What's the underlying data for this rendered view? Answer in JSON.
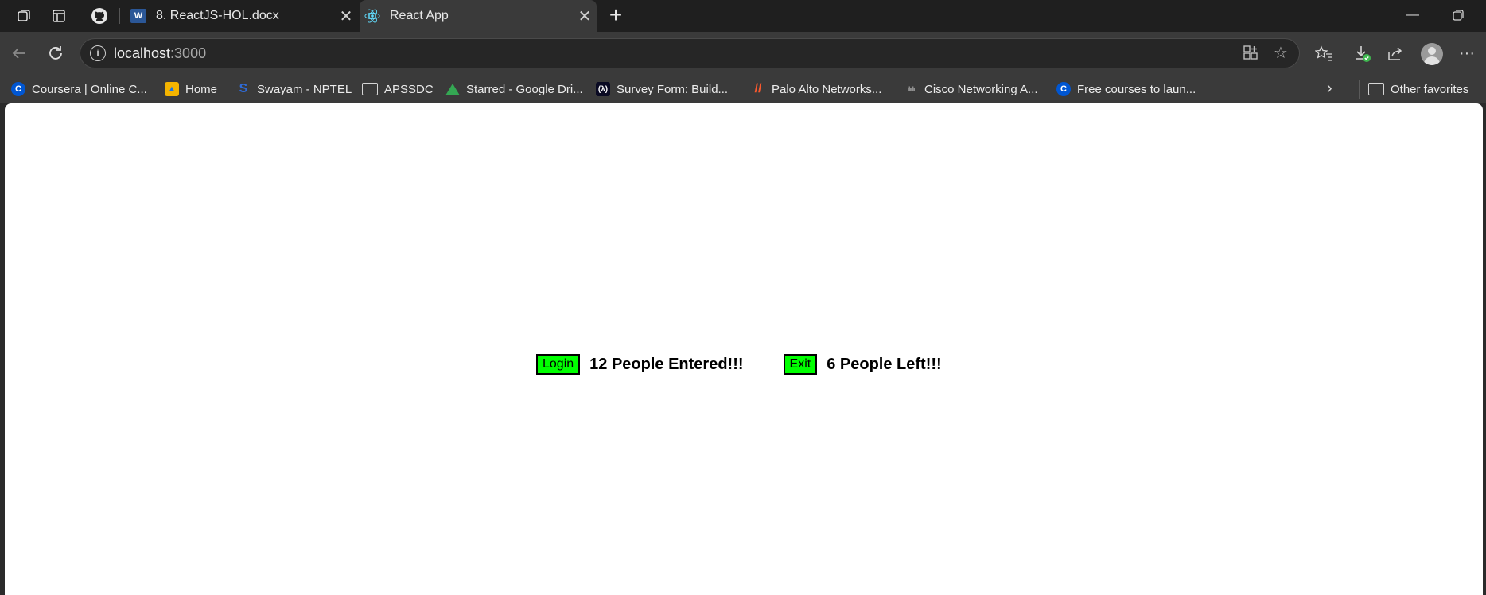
{
  "browser": {
    "tabs": [
      {
        "title": "8. ReactJS-HOL.docx",
        "active": false,
        "icon": "word-icon"
      },
      {
        "title": "React App",
        "active": true,
        "icon": "react-icon"
      }
    ],
    "address": {
      "host": "localhost",
      "port": ":3000"
    },
    "favorites": [
      {
        "label": "Coursera | Online C...",
        "icon": "coursera-icon"
      },
      {
        "label": "Home",
        "icon": "home-icon"
      },
      {
        "label": "Swayam - NPTEL",
        "icon": "swayam-icon"
      },
      {
        "label": "APSSDC",
        "icon": "folder-icon"
      },
      {
        "label": "Starred - Google Dri...",
        "icon": "google-drive-icon"
      },
      {
        "label": "Survey Form: Build...",
        "icon": "freecodecamp-icon"
      },
      {
        "label": "Palo Alto Networks...",
        "icon": "palo-alto-icon"
      },
      {
        "label": "Cisco Networking A...",
        "icon": "cisco-icon"
      },
      {
        "label": "Free courses to laun...",
        "icon": "coursera-icon"
      }
    ],
    "other_favorites": "Other favorites"
  },
  "app": {
    "login_button": "Login",
    "entered_text": "12 People Entered!!!",
    "exit_button": "Exit",
    "left_text": "6 People Left!!!",
    "button_color": "#00ff00"
  }
}
